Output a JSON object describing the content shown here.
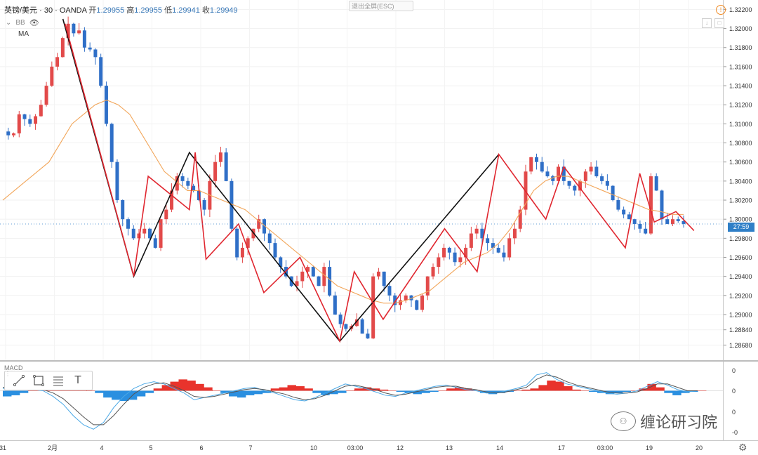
{
  "legend": {
    "symbol": "英镑/美元 · 30 · OANDA",
    "open_label": "开",
    "open": "1.29955",
    "high_label": "高",
    "high": "1.29955",
    "low_label": "低",
    "low": "1.29941",
    "close_label": "收",
    "close": "1.29949"
  },
  "indicators": {
    "bb": "BB",
    "ma": "MA",
    "macd": "MACD"
  },
  "exit_fullscreen": "退出全屏(ESC)",
  "current_price_tag": "27:59",
  "watermark": "缠论研习院",
  "price_axis": [
    "1.32200",
    "1.32000",
    "1.31800",
    "1.31600",
    "1.31400",
    "1.31200",
    "1.31000",
    "1.30800",
    "1.30600",
    "1.30400",
    "1.30200",
    "1.30000",
    "1.29800",
    "1.29600",
    "1.29400",
    "1.29200",
    "1.29000",
    "1.28840",
    "1.28680"
  ],
  "macd_axis": [
    "0",
    "0",
    "0",
    "-0"
  ],
  "time_axis": [
    "31",
    "2月",
    "4",
    "5",
    "6",
    "7",
    "10",
    "03:00",
    "12",
    "13",
    "14",
    "17",
    "03:00",
    "19",
    "20"
  ],
  "colors": {
    "bull": "#e24a4a",
    "bear": "#2f6fc7",
    "ma": "#f2a65a",
    "macd_line": "#4aa8e6",
    "signal_line": "#555555",
    "hist_pos": "#e8332c",
    "hist_neg": "#2a8fe0",
    "bi_lines": "#e0262f",
    "segment_lines": "#111111"
  },
  "chart_data": {
    "type": "line",
    "price_ylim": [
      1.2858,
      1.3224
    ],
    "price_path": [
      1.3092,
      1.3088,
      1.309,
      1.311,
      1.3105,
      1.31,
      1.3108,
      1.312,
      1.314,
      1.316,
      1.317,
      1.319,
      1.3205,
      1.3195,
      1.3198,
      1.318,
      1.3178,
      1.317,
      1.314,
      1.31,
      1.306,
      1.302,
      1.3,
      1.299,
      1.298,
      1.2985,
      1.299,
      1.298,
      1.297,
      1.3,
      1.301,
      1.303,
      1.3045,
      1.304,
      1.3035,
      1.303,
      1.302,
      1.301,
      1.304,
      1.306,
      1.307,
      1.304,
      1.299,
      1.296,
      1.297,
      1.298,
      1.299,
      1.3,
      1.2985,
      1.2975,
      1.296,
      1.295,
      1.294,
      1.293,
      1.2935,
      1.2945,
      1.295,
      1.294,
      1.293,
      1.295,
      1.292,
      1.29,
      1.289,
      1.2885,
      1.2888,
      1.2895,
      1.288,
      1.2875,
      1.294,
      1.2945,
      1.293,
      1.292,
      1.291,
      1.2915,
      1.292,
      1.2915,
      1.2905,
      1.292,
      1.294,
      1.295,
      1.296,
      1.297,
      1.2965,
      1.2955,
      1.296,
      1.297,
      1.2985,
      1.299,
      1.298,
      1.2975,
      1.297,
      1.2965,
      1.296,
      1.298,
      1.299,
      1.301,
      1.305,
      1.3065,
      1.306,
      1.305,
      1.3045,
      1.304,
      1.3055,
      1.304,
      1.3035,
      1.303,
      1.304,
      1.305,
      1.3055,
      1.3045,
      1.304,
      1.3035,
      1.302,
      1.301,
      1.3005,
      1.3,
      1.2995,
      1.299,
      1.2985,
      1.3045,
      1.303,
      1.3,
      1.2995,
      1.3,
      1.2998,
      1.2995
    ],
    "ma_values": [
      1.302,
      1.303,
      1.304,
      1.305,
      1.306,
      1.308,
      1.31,
      1.311,
      1.312,
      1.3125,
      1.312,
      1.311,
      1.309,
      1.307,
      1.305,
      1.304,
      1.303,
      1.303,
      1.3025,
      1.302,
      1.3015,
      1.301,
      1.3,
      1.299,
      1.298,
      1.297,
      1.296,
      1.295,
      1.294,
      1.293,
      1.2925,
      1.292,
      1.2915,
      1.2912,
      1.2912,
      1.2915,
      1.292,
      1.2925,
      1.2935,
      1.2945,
      1.2955,
      1.296,
      1.2965,
      1.2975,
      1.299,
      1.301,
      1.303,
      1.304,
      1.3045,
      1.3045,
      1.304,
      1.3035,
      1.303,
      1.3025,
      1.302,
      1.3015,
      1.301,
      1.3008,
      1.3005,
      1.3005
    ],
    "bi_points": [
      [
        0.09,
        1.3205
      ],
      [
        0.185,
        1.294
      ],
      [
        0.205,
        1.3045
      ],
      [
        0.262,
        1.301
      ],
      [
        0.27,
        1.307
      ],
      [
        0.285,
        1.2958
      ],
      [
        0.33,
        1.2995
      ],
      [
        0.365,
        1.2923
      ],
      [
        0.415,
        1.296
      ],
      [
        0.47,
        1.2872
      ],
      [
        0.49,
        1.2945
      ],
      [
        0.53,
        1.2895
      ],
      [
        0.615,
        1.299
      ],
      [
        0.66,
        1.2945
      ],
      [
        0.69,
        1.3068
      ],
      [
        0.755,
        1.3
      ],
      [
        0.78,
        1.3055
      ],
      [
        0.865,
        1.297
      ],
      [
        0.885,
        1.3048
      ],
      [
        0.905,
        1.2997
      ],
      [
        0.935,
        1.3008
      ],
      [
        0.96,
        1.2988
      ]
    ],
    "segment_points": [
      [
        0.087,
        1.321
      ],
      [
        0.185,
        1.294
      ],
      [
        0.262,
        1.307
      ],
      [
        0.47,
        1.2872
      ],
      [
        0.69,
        1.3068
      ]
    ],
    "macd_hist": [
      -0.05,
      -0.04,
      -0.02,
      0.02,
      0.04,
      0.06,
      0.05,
      0.03,
      0.02,
      0.01,
      0.0,
      -0.02,
      -0.06,
      -0.08,
      -0.09,
      -0.08,
      -0.05,
      -0.02,
      0.02,
      0.05,
      0.08,
      0.1,
      0.09,
      0.06,
      0.03,
      0.0,
      -0.02,
      -0.05,
      -0.06,
      -0.04,
      -0.03,
      -0.02,
      0.02,
      0.03,
      0.05,
      0.04,
      0.02,
      -0.02,
      -0.04,
      -0.03,
      -0.02,
      0.0,
      0.02,
      0.03,
      0.02,
      0.01,
      0.0,
      -0.01,
      -0.02,
      -0.03,
      -0.02,
      -0.01,
      0.0,
      0.02,
      0.03,
      0.02,
      0.0,
      -0.02,
      -0.03,
      -0.02,
      -0.01,
      0.0,
      0.01,
      0.02,
      0.05,
      0.09,
      0.08,
      0.04,
      0.01,
      0.0,
      -0.01,
      -0.02,
      -0.03,
      -0.02,
      -0.01,
      0.0,
      0.02,
      0.06,
      0.03,
      -0.02,
      -0.04,
      -0.02,
      -0.01,
      0.0
    ],
    "macd_line": [
      0.02,
      0.03,
      0.02,
      0.01,
      0.0,
      -0.05,
      -0.12,
      -0.22,
      -0.3,
      -0.34,
      -0.28,
      -0.15,
      -0.05,
      0.02,
      0.06,
      0.08,
      0.06,
      0.02,
      -0.02,
      -0.08,
      -0.06,
      -0.04,
      -0.02,
      0.0,
      0.02,
      0.03,
      0.0,
      -0.02,
      -0.05,
      -0.08,
      -0.09,
      -0.06,
      -0.02,
      0.02,
      0.06,
      0.04,
      0.02,
      -0.01,
      -0.04,
      -0.05,
      -0.02,
      0.0,
      0.02,
      0.04,
      0.05,
      0.03,
      0.01,
      0.0,
      -0.02,
      -0.02,
      0.0,
      0.02,
      0.05,
      0.14,
      0.16,
      0.1,
      0.06,
      0.04,
      0.02,
      0.0,
      -0.02,
      -0.03,
      -0.02,
      0.0,
      0.04,
      0.08,
      0.05,
      0.01,
      -0.01,
      0.0
    ],
    "signal_line": [
      0.03,
      0.03,
      0.03,
      0.02,
      0.01,
      -0.02,
      -0.07,
      -0.15,
      -0.23,
      -0.3,
      -0.3,
      -0.22,
      -0.12,
      -0.03,
      0.03,
      0.06,
      0.07,
      0.04,
      0.0,
      -0.05,
      -0.06,
      -0.05,
      -0.03,
      -0.01,
      0.01,
      0.02,
      0.01,
      -0.01,
      -0.03,
      -0.06,
      -0.08,
      -0.07,
      -0.04,
      0.0,
      0.04,
      0.05,
      0.03,
      0.01,
      -0.02,
      -0.04,
      -0.03,
      -0.01,
      0.01,
      0.03,
      0.04,
      0.04,
      0.02,
      0.01,
      -0.01,
      -0.02,
      -0.01,
      0.01,
      0.03,
      0.1,
      0.14,
      0.12,
      0.08,
      0.05,
      0.03,
      0.01,
      -0.01,
      -0.02,
      -0.02,
      -0.01,
      0.02,
      0.06,
      0.06,
      0.03,
      0.0,
      0.0
    ],
    "macd_ylim": [
      -0.4,
      0.22
    ]
  }
}
